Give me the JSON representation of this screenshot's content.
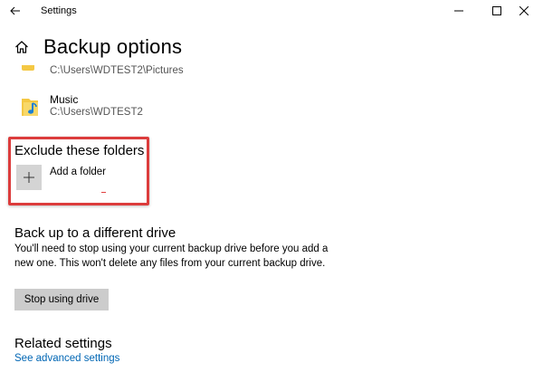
{
  "titlebar": {
    "title": "Settings",
    "icons": {
      "back": "arrow-left-icon",
      "minimize": "minimize-icon",
      "maximize": "maximize-icon",
      "close": "close-icon"
    }
  },
  "header": {
    "title": "Backup options",
    "icon": "home-icon"
  },
  "folders": [
    {
      "name": "",
      "path": "C:\\Users\\WDTEST2\\Pictures",
      "icon": "folder-icon"
    },
    {
      "name": "Music",
      "path": "C:\\Users\\WDTEST2",
      "icon": "music-folder-icon"
    }
  ],
  "exclude": {
    "title": "Exclude these folders",
    "add_label": "Add a folder",
    "add_icon": "plus-icon"
  },
  "drive": {
    "title": "Back up to a different drive",
    "description": "You'll need to stop using your current backup drive before you add a new one. This won't delete any files from your current backup drive.",
    "button_label": "Stop using drive"
  },
  "related": {
    "title": "Related settings",
    "link": "See advanced settings"
  },
  "colors": {
    "accent_link": "#0066b4",
    "highlight_border": "#dc3c3c",
    "button_bg": "#cccccc",
    "folder_yellow": "#f4c844"
  }
}
